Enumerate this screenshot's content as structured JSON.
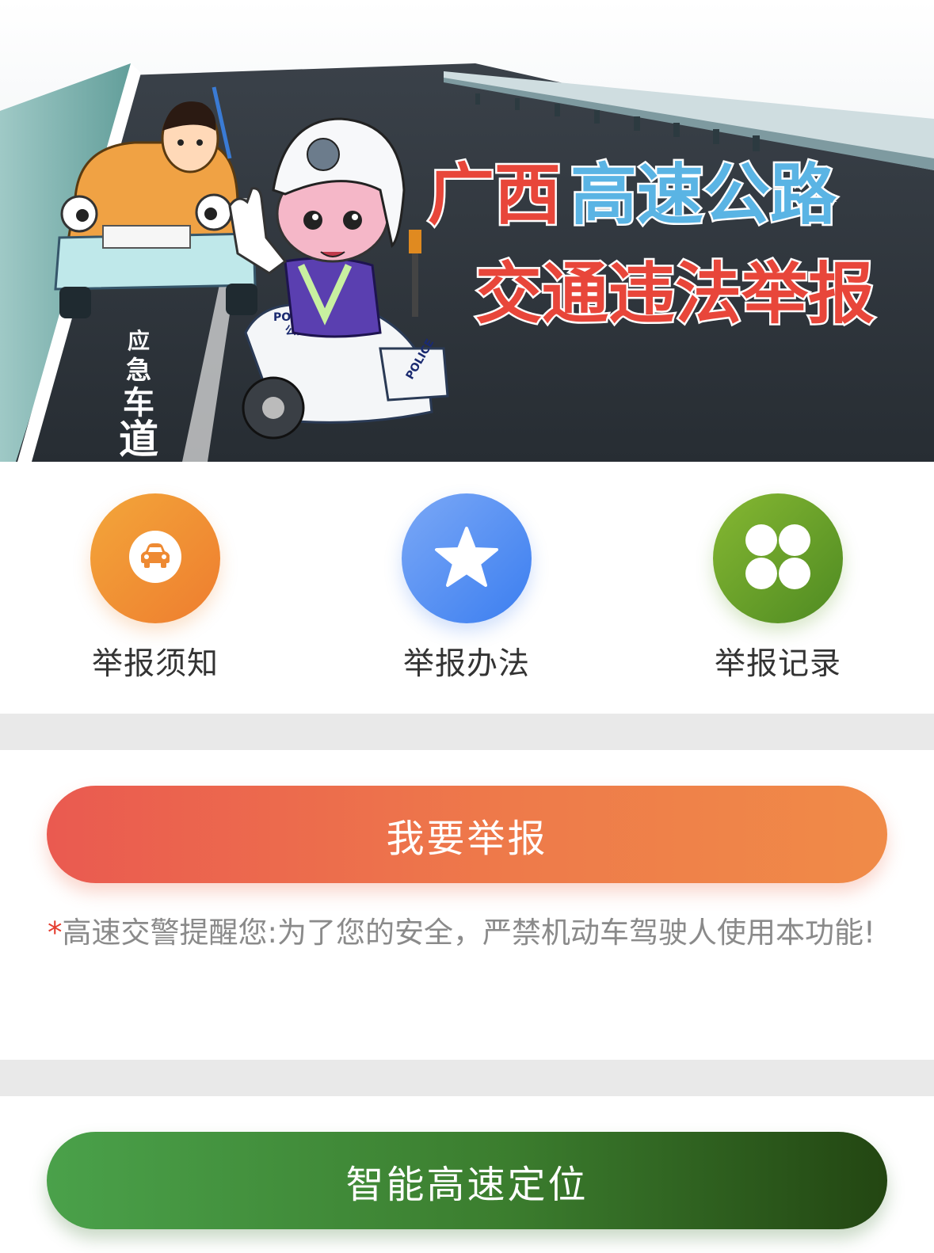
{
  "banner": {
    "title_line1_red": "广西",
    "title_line1_blue": "高速公路",
    "title_line2": "交通违法举报",
    "lane_sign": [
      "应",
      "急",
      "车",
      "道"
    ],
    "police_text": "POLICE",
    "police_cn": "公安"
  },
  "menu": {
    "items": [
      {
        "label": "举报须知",
        "icon": "car-icon",
        "color": "#ee8a33"
      },
      {
        "label": "举报办法",
        "icon": "star-icon",
        "color": "#4a86f0"
      },
      {
        "label": "举报记录",
        "icon": "clover-icon",
        "color": "#5a9a28"
      }
    ]
  },
  "report_button": {
    "label": "我要举报"
  },
  "notice": {
    "asterisk": "*",
    "text": "高速交警提醒您:为了您的安全，严禁机动车驾驶人使用本功能!"
  },
  "locate_button": {
    "label": "智能高速定位"
  },
  "colors": {
    "report_gradient_start": "#ea5a50",
    "report_gradient_end": "#f08b48",
    "locate_gradient_start": "#4aa14a",
    "locate_gradient_end": "#234612",
    "separator": "#e9e9e9"
  }
}
